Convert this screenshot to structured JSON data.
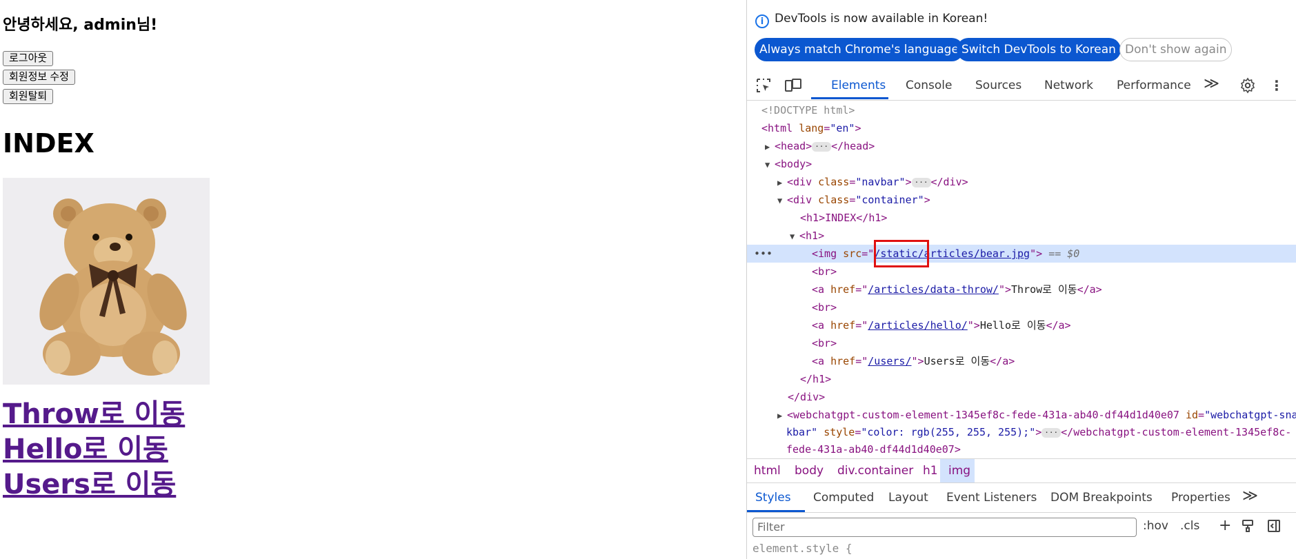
{
  "page": {
    "greeting": "안녕하세요, admin님!",
    "buttons": {
      "logout": "로그아웃",
      "edit_profile": "회원정보 수정",
      "withdraw": "회원탈퇴"
    },
    "heading": "INDEX",
    "links": [
      "Throw로 이동",
      "Hello로 이동",
      "Users로 이동"
    ]
  },
  "devtools": {
    "infobar": {
      "message": "DevTools is now available in Korean!",
      "btn_match": "Always match Chrome's language",
      "btn_switch": "Switch DevTools to Korean",
      "btn_dismiss": "Don't show again"
    },
    "tabs": [
      "Elements",
      "Console",
      "Sources",
      "Network",
      "Performance"
    ],
    "more_tabs": "≫",
    "dom": {
      "doctype": "<!DOCTYPE html>",
      "html_open": "<html ",
      "html_attr": "lang",
      "html_val": "\"en\"",
      "head": "<head>",
      "head_close": "</head>",
      "body": "<body>",
      "div_open": "<div ",
      "attr_class": "class",
      "navbar_val": "\"navbar\"",
      "div_close": "</div>",
      "container_val": "\"container\"",
      "h1_index": "<h1>INDEX</h1>",
      "h1_open": "<h1>",
      "img_open": "<img ",
      "attr_src": "src",
      "img_src": "/static/articles/bear.jpg",
      "dollar": "== $0",
      "br": "<br>",
      "a_open": "<a ",
      "attr_href": "href",
      "href1": "/articles/data-throw/",
      "text1": "Throw로 이동",
      "href2": "/articles/hello/",
      "text2": "Hello로 이동",
      "href3": "/users/",
      "text3": "Users로 이동",
      "a_close": "</a>",
      "h1_close": "</h1>",
      "custom_open": "<webchatgpt-custom-element-1345ef8c-fede-431a-ab40-df44d1d40e07 ",
      "attr_id": "id",
      "custom_id_val": "\"webchatgpt-snac",
      "custom_line2_val": "kbar\"",
      "attr_style": "style",
      "style_val": "\"color: rgb(255, 255, 255);\"",
      "custom_close_a": "</webchatgpt-custom-element-1345ef8c-",
      "custom_close_b": "fede-431a-ab40-df44d1d40e07>"
    },
    "breadcrumbs": [
      "html",
      "body",
      "div.container",
      "h1",
      "img"
    ],
    "style_tabs": [
      "Styles",
      "Computed",
      "Layout",
      "Event Listeners",
      "DOM Breakpoints",
      "Properties"
    ],
    "filter_placeholder": "Filter",
    "hov": ":hov",
    "cls": ".cls",
    "element_style": "element.style {"
  }
}
